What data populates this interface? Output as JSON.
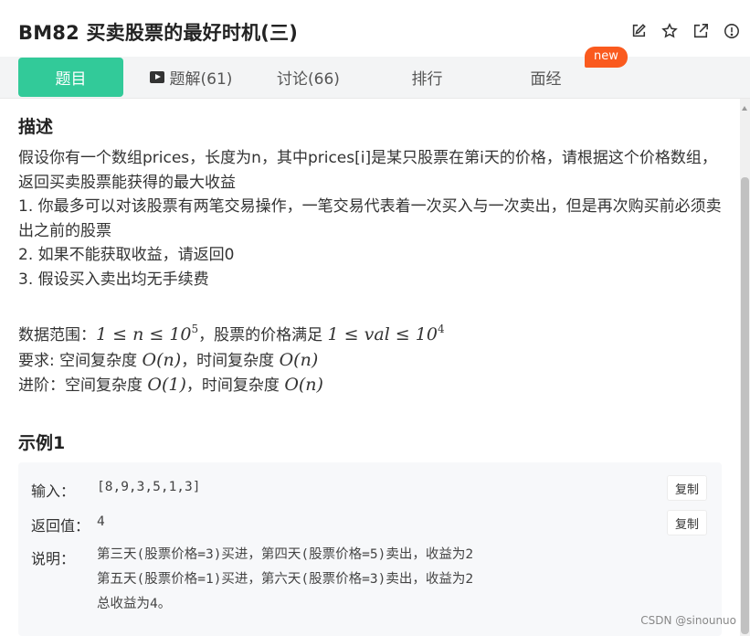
{
  "header": {
    "title": "BM82  买卖股票的最好时机(三)",
    "icons": [
      "edit-icon",
      "star-icon",
      "external-link-icon",
      "info-icon"
    ]
  },
  "tabs": [
    {
      "label": "题目",
      "active": true
    },
    {
      "label": "题解(61)",
      "icon": "video-icon"
    },
    {
      "label": "讨论(66)"
    },
    {
      "label": "排行"
    },
    {
      "label": "面经"
    }
  ],
  "new_badge": "new",
  "description": {
    "title": "描述",
    "para1": "假设你有一个数组prices，长度为n，其中prices[i]是某只股票在第i天的价格，请根据这个价格数组，返回买卖股票能获得的最大收益",
    "item1": "1. 你最多可以对该股票有两笔交易操作，一笔交易代表着一次买入与一次卖出，但是再次购买前必须卖出之前的股票",
    "item2": "2. 如果不能获取收益，请返回0",
    "item3": "3. 假设买入卖出均无手续费",
    "range_label": "数据范围：",
    "range_expr1": "1 ≤ n ≤ 10",
    "range_exp1": "5",
    "range_mid": "，股票的价格满足 ",
    "range_expr2": "1 ≤ val ≤ 10",
    "range_exp2": "4",
    "req_label": "要求: 空间复杂度 ",
    "req_space": "O(n)",
    "req_mid": "，时间复杂度 ",
    "req_time": "O(n)",
    "adv_label": "进阶：空间复杂度 ",
    "adv_space": "O(1)",
    "adv_mid": "，时间复杂度 ",
    "adv_time": "O(n)"
  },
  "example": {
    "title": "示例1",
    "input_label": "输入：",
    "input_value": "[8,9,3,5,1,3]",
    "return_label": "返回值：",
    "return_value": "4",
    "explain_label": "说明：",
    "explain_lines": [
      "第三天(股票价格=3)买进，第四天(股票价格=5)卖出，收益为2",
      "第五天(股票价格=1)买进，第六天(股票价格=3)卖出，收益为2",
      "总收益为4。"
    ],
    "copy_label": "复制"
  },
  "watermark": "CSDN @sinounuo",
  "colors": {
    "accent": "#32ca99",
    "badge": "#fa5a1e"
  }
}
